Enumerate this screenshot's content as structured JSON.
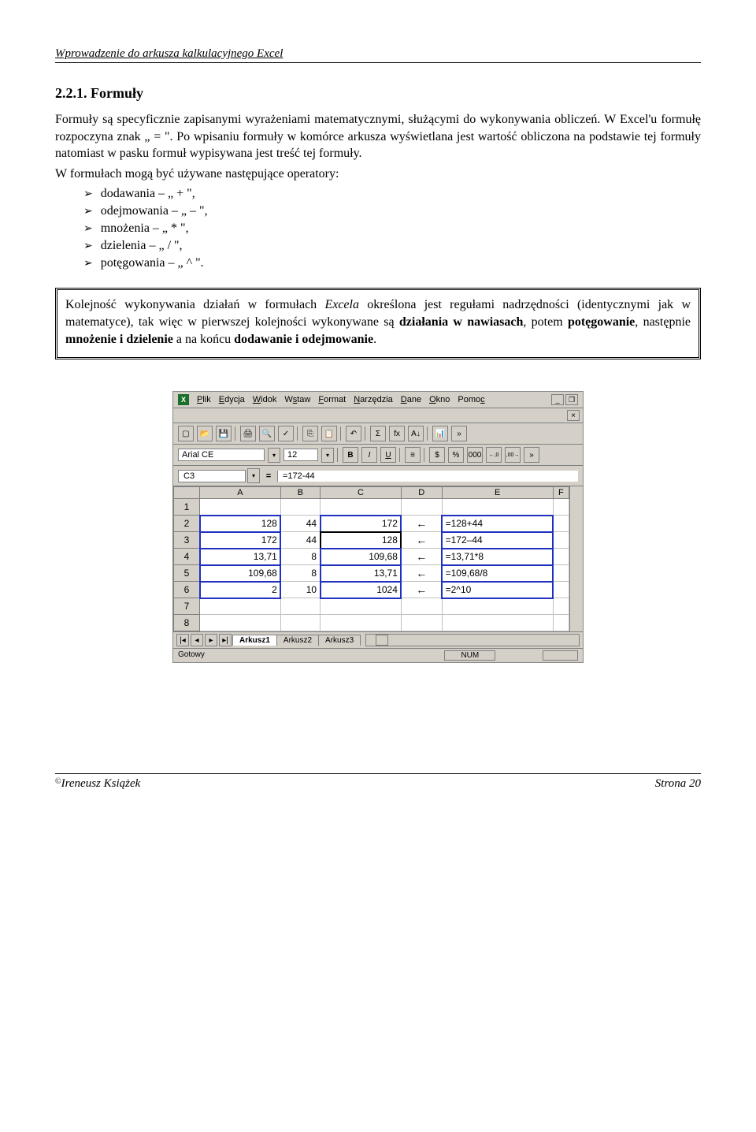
{
  "header": {
    "title": "Wprowadzenie do arkusza kalkulacyjnego Excel"
  },
  "section": {
    "number": "2.2.1. Formuły"
  },
  "para1": "Formuły są specyficznie zapisanymi wyrażeniami matematycznymi, służącymi do wykonywania obliczeń. W Excel'u formułę rozpoczyna znak „ = \". Po wpisaniu formuły w komórce arkusza wyświetlana jest wartość obliczona na podstawie tej formuły natomiast w pasku formuł wypisywana jest  treść tej formuły.",
  "para2": "W formułach mogą być używane następujące operatory:",
  "ops": [
    "dodawania – „ + \",",
    "odejmowania – „ – \",",
    "mnożenia – „ * \",",
    "dzielenia – „ / \",",
    "potęgowania – „ ^ \"."
  ],
  "rulebox_parts": {
    "p1a": "Kolejność wykonywania działań w formułach ",
    "p1b_italic": "Excela",
    "p1c": " określona jest regułami nadrzędności (identycznymi jak w matematyce), tak więc w pierwszej kolejności wykonywane są ",
    "b1": "działania w nawiasach",
    "p2": ", potem ",
    "b2": "potęgowanie",
    "p3": ", następnie ",
    "b3": "mnożenie i dzielenie",
    "p4": " a na końcu ",
    "b4": "dodawanie i odejmowanie",
    "p5": "."
  },
  "excel": {
    "menu": [
      "Plik",
      "Edycja",
      "Widok",
      "Wstaw",
      "Format",
      "Narzędzia",
      "Dane",
      "Okno",
      "Pomoc"
    ],
    "font_name": "Arial CE",
    "font_size": "12",
    "cell_ref": "C3",
    "formula": "=172-44",
    "cols": [
      "A",
      "B",
      "C",
      "D",
      "E",
      "F"
    ],
    "rows": [
      {
        "n": "1",
        "A": "",
        "B": "",
        "C": "",
        "D": "",
        "E": ""
      },
      {
        "n": "2",
        "A": "128",
        "B": "44",
        "C": "172",
        "D": "←",
        "E": "=128+44"
      },
      {
        "n": "3",
        "A": "172",
        "B": "44",
        "C": "128",
        "D": "←",
        "E": "=172–44"
      },
      {
        "n": "4",
        "A": "13,71",
        "B": "8",
        "C": "109,68",
        "D": "←",
        "E": "=13,71*8"
      },
      {
        "n": "5",
        "A": "109,68",
        "B": "8",
        "C": "13,71",
        "D": "←",
        "E": "=109,68/8"
      },
      {
        "n": "6",
        "A": "2",
        "B": "10",
        "C": "1024",
        "D": "←",
        "E": "=2^10"
      },
      {
        "n": "7",
        "A": "",
        "B": "",
        "C": "",
        "D": "",
        "E": ""
      },
      {
        "n": "8",
        "A": "",
        "B": "",
        "C": "",
        "D": "",
        "E": ""
      }
    ],
    "sheets": [
      "Arkusz1",
      "Arkusz2",
      "Arkusz3"
    ],
    "status_ready": "Gotowy",
    "status_num": "NUM"
  },
  "toolbar_labels": {
    "b": "B",
    "i": "I",
    "u": "U",
    "sigma": "Σ",
    "fx": "fx",
    "pct": "%",
    "thou": "000",
    "dec_inc": "←,0",
    "dec_dec": ",00→",
    "more": "»"
  },
  "footer": {
    "author": "Ireneusz Książek",
    "page": "Strona 20",
    "copy": "©"
  }
}
